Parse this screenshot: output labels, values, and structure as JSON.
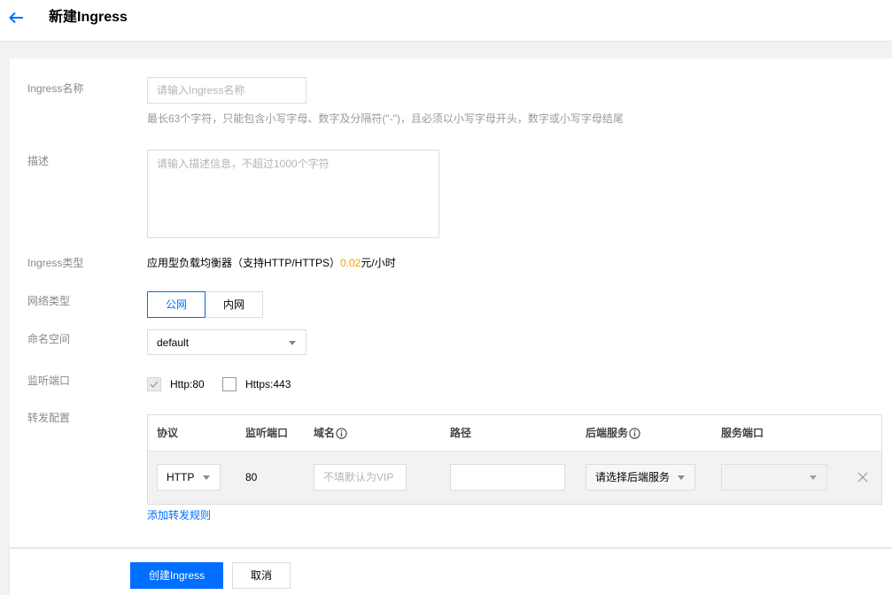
{
  "header": {
    "back_icon": "arrow-left-icon",
    "title": "新建Ingress"
  },
  "form": {
    "name": {
      "label": "Ingress名称",
      "placeholder": "请输入Ingress名称",
      "value": "",
      "hint": "最长63个字符，只能包含小写字母、数字及分隔符(\"-\")，且必须以小写字母开头，数字或小写字母结尾"
    },
    "description": {
      "label": "描述",
      "placeholder": "请输入描述信息，不超过1000个字符",
      "value": ""
    },
    "ingress_type": {
      "label": "Ingress类型",
      "text": "应用型负载均衡器（支持HTTP/HTTPS）",
      "price": "0.02",
      "price_unit": "元/小时"
    },
    "network_type": {
      "label": "网络类型",
      "options": [
        {
          "label": "公网",
          "selected": true
        },
        {
          "label": "内网",
          "selected": false
        }
      ]
    },
    "namespace": {
      "label": "命名空间",
      "value": "default",
      "icon": "caret-down-icon"
    },
    "listen_ports": {
      "label": "监听端口",
      "options": [
        {
          "label": "Http:80",
          "checked": true,
          "disabled": true
        },
        {
          "label": "Https:443",
          "checked": false,
          "disabled": false
        }
      ]
    },
    "forwarding": {
      "label": "转发配置",
      "columns": [
        {
          "label": "协议"
        },
        {
          "label": "监听端口"
        },
        {
          "label": "域名",
          "icon": "info-icon"
        },
        {
          "label": "路径"
        },
        {
          "label": "后端服务",
          "icon": "info-icon"
        },
        {
          "label": "服务端口"
        }
      ],
      "rows": [
        {
          "protocol": "HTTP",
          "listen_port": "80",
          "domain": "",
          "domain_placeholder": "不填默认为VIP",
          "path": "",
          "backend_service": "请选择后端服务",
          "service_port": "",
          "service_port_disabled": true,
          "remove_icon": "close-icon"
        }
      ],
      "add_rule_label": "添加转发规则"
    }
  },
  "footer": {
    "create_label": "创建Ingress",
    "cancel_label": "取消"
  },
  "colors": {
    "primary": "#006eff",
    "price": "#ff9d00",
    "page_background": "#f2f2f2",
    "label_text": "#888888"
  }
}
